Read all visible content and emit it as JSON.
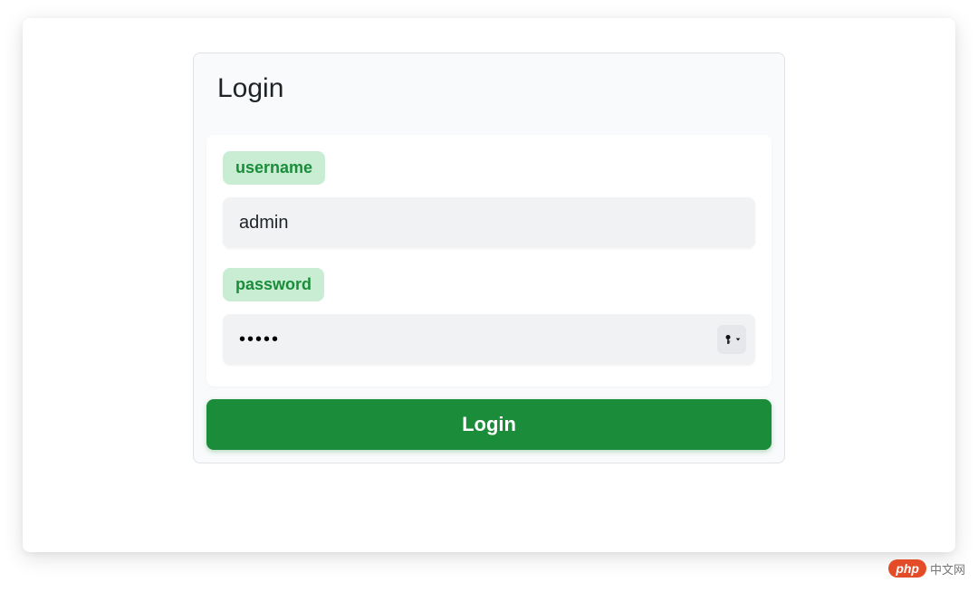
{
  "panel": {
    "title": "Login"
  },
  "form": {
    "username": {
      "label": "username",
      "value": "admin"
    },
    "password": {
      "label": "password",
      "value": "•••••"
    }
  },
  "actions": {
    "login_button": "Login"
  },
  "watermark": {
    "badge": "php",
    "text": "中文网"
  }
}
